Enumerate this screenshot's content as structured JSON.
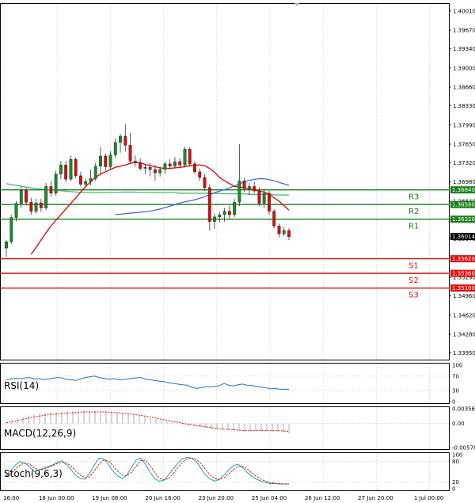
{
  "chart_data": {
    "type": "candlestick",
    "instrument_timeframe": "",
    "main": {
      "price_ticks": [
        1.4001,
        1.3967,
        1.3934,
        1.39,
        1.3866,
        1.3833,
        1.3799,
        1.3765,
        1.3732,
        1.3698,
        1.3664,
        1.3631,
        1.3597,
        1.3563,
        1.3529,
        1.3496,
        1.3462,
        1.3428,
        1.3395
      ],
      "price_tick_labels": [
        "1.40010",
        "1.39670",
        "1.39340",
        "1.39000",
        "1.38660",
        "1.38330",
        "1.37990",
        "1.37650",
        "1.37320",
        "1.36980",
        "1.36640",
        "1.36310",
        "1.35970",
        "1.35630",
        "1.35290",
        "1.34960",
        "1.34620",
        "1.34280",
        "1.33950"
      ],
      "ylim": [
        1.3386,
        1.4012
      ],
      "x_labels": [
        "16:00",
        "18 Jun 00:00",
        "19 Jun 08:00",
        "20 Jun 16:00",
        "23 Jun 20:00",
        "25 Jun 04:00",
        "26 Jun 12:00",
        "27 Jun 20:00",
        "1 Jul 00:00"
      ],
      "x_label_positions": [
        0,
        12,
        24,
        36,
        48,
        60,
        72,
        84,
        96
      ],
      "bars_count": 100,
      "current_price": "1.36014",
      "current_price_value": 1.36014,
      "levels": [
        {
          "name": "R3",
          "price": 1.3684,
          "label": "1.36840",
          "color": "#1a7f1a"
        },
        {
          "name": "R2",
          "price": 1.3658,
          "label": "1.36580",
          "color": "#1a7f1a"
        },
        {
          "name": "R1",
          "price": 1.3632,
          "label": "1.36320",
          "color": "#1a7f1a"
        },
        {
          "name": "S1",
          "price": 1.3562,
          "label": "1.35620",
          "color": "#e01010"
        },
        {
          "name": "S2",
          "price": 1.3536,
          "label": "1.35360",
          "color": "#e01010"
        },
        {
          "name": "S3",
          "price": 1.351,
          "label": "1.35100",
          "color": "#e01010"
        }
      ],
      "candles": [
        {
          "o": 1.3581,
          "h": 1.3595,
          "l": 1.3566,
          "c": 1.3592
        },
        {
          "o": 1.3592,
          "h": 1.364,
          "l": 1.3588,
          "c": 1.3635
        },
        {
          "o": 1.3635,
          "h": 1.3664,
          "l": 1.3628,
          "c": 1.366
        },
        {
          "o": 1.366,
          "h": 1.369,
          "l": 1.3652,
          "c": 1.3683
        },
        {
          "o": 1.3683,
          "h": 1.3688,
          "l": 1.3656,
          "c": 1.3662
        },
        {
          "o": 1.3662,
          "h": 1.367,
          "l": 1.364,
          "c": 1.3646
        },
        {
          "o": 1.3646,
          "h": 1.3668,
          "l": 1.3642,
          "c": 1.3661
        },
        {
          "o": 1.3661,
          "h": 1.3668,
          "l": 1.3645,
          "c": 1.3652
        },
        {
          "o": 1.3652,
          "h": 1.3696,
          "l": 1.3648,
          "c": 1.369
        },
        {
          "o": 1.369,
          "h": 1.37,
          "l": 1.3672,
          "c": 1.3678
        },
        {
          "o": 1.3678,
          "h": 1.3718,
          "l": 1.3674,
          "c": 1.3712
        },
        {
          "o": 1.3712,
          "h": 1.3735,
          "l": 1.3703,
          "c": 1.3728
        },
        {
          "o": 1.3728,
          "h": 1.3735,
          "l": 1.3698,
          "c": 1.3703
        },
        {
          "o": 1.3703,
          "h": 1.3745,
          "l": 1.37,
          "c": 1.3738
        },
        {
          "o": 1.3738,
          "h": 1.3742,
          "l": 1.3704,
          "c": 1.3709
        },
        {
          "o": 1.3709,
          "h": 1.3716,
          "l": 1.369,
          "c": 1.3694
        },
        {
          "o": 1.3694,
          "h": 1.3704,
          "l": 1.3688,
          "c": 1.3699
        },
        {
          "o": 1.3699,
          "h": 1.372,
          "l": 1.3692,
          "c": 1.3704
        },
        {
          "o": 1.3704,
          "h": 1.3732,
          "l": 1.37,
          "c": 1.3726
        },
        {
          "o": 1.3726,
          "h": 1.376,
          "l": 1.3712,
          "c": 1.3744
        },
        {
          "o": 1.3744,
          "h": 1.3748,
          "l": 1.3718,
          "c": 1.3725
        },
        {
          "o": 1.3725,
          "h": 1.3752,
          "l": 1.372,
          "c": 1.3746
        },
        {
          "o": 1.3746,
          "h": 1.3775,
          "l": 1.374,
          "c": 1.3768
        },
        {
          "o": 1.3768,
          "h": 1.3783,
          "l": 1.375,
          "c": 1.3779
        },
        {
          "o": 1.3779,
          "h": 1.38,
          "l": 1.3752,
          "c": 1.3763
        },
        {
          "o": 1.3763,
          "h": 1.3785,
          "l": 1.373,
          "c": 1.3735
        },
        {
          "o": 1.3735,
          "h": 1.3745,
          "l": 1.3725,
          "c": 1.3732
        },
        {
          "o": 1.3732,
          "h": 1.374,
          "l": 1.3718,
          "c": 1.3722
        },
        {
          "o": 1.3722,
          "h": 1.373,
          "l": 1.3712,
          "c": 1.3724
        },
        {
          "o": 1.3724,
          "h": 1.3732,
          "l": 1.3708,
          "c": 1.372
        },
        {
          "o": 1.372,
          "h": 1.3728,
          "l": 1.37,
          "c": 1.3714
        },
        {
          "o": 1.3714,
          "h": 1.3725,
          "l": 1.3708,
          "c": 1.372
        },
        {
          "o": 1.372,
          "h": 1.3734,
          "l": 1.3712,
          "c": 1.373
        },
        {
          "o": 1.373,
          "h": 1.3738,
          "l": 1.372,
          "c": 1.3726
        },
        {
          "o": 1.3726,
          "h": 1.3742,
          "l": 1.3722,
          "c": 1.3734
        },
        {
          "o": 1.3734,
          "h": 1.374,
          "l": 1.3722,
          "c": 1.3728
        },
        {
          "o": 1.3728,
          "h": 1.376,
          "l": 1.3724,
          "c": 1.3756
        },
        {
          "o": 1.3756,
          "h": 1.376,
          "l": 1.3725,
          "c": 1.373
        },
        {
          "o": 1.373,
          "h": 1.3735,
          "l": 1.3712,
          "c": 1.3716
        },
        {
          "o": 1.3716,
          "h": 1.3722,
          "l": 1.37,
          "c": 1.3706
        },
        {
          "o": 1.3706,
          "h": 1.3712,
          "l": 1.3682,
          "c": 1.3688
        },
        {
          "o": 1.3688,
          "h": 1.3694,
          "l": 1.3612,
          "c": 1.3628
        },
        {
          "o": 1.3628,
          "h": 1.3642,
          "l": 1.3615,
          "c": 1.3636
        },
        {
          "o": 1.3636,
          "h": 1.3645,
          "l": 1.3626,
          "c": 1.364
        },
        {
          "o": 1.364,
          "h": 1.3652,
          "l": 1.3628,
          "c": 1.3646
        },
        {
          "o": 1.3646,
          "h": 1.3656,
          "l": 1.3632,
          "c": 1.364
        },
        {
          "o": 1.364,
          "h": 1.3668,
          "l": 1.3636,
          "c": 1.3662
        },
        {
          "o": 1.3662,
          "h": 1.3765,
          "l": 1.3655,
          "c": 1.37
        },
        {
          "o": 1.37,
          "h": 1.3705,
          "l": 1.368,
          "c": 1.3686
        },
        {
          "o": 1.3686,
          "h": 1.3696,
          "l": 1.3675,
          "c": 1.369
        },
        {
          "o": 1.369,
          "h": 1.3698,
          "l": 1.3678,
          "c": 1.3682
        },
        {
          "o": 1.3682,
          "h": 1.3688,
          "l": 1.3655,
          "c": 1.366
        },
        {
          "o": 1.366,
          "h": 1.3686,
          "l": 1.3652,
          "c": 1.3678
        },
        {
          "o": 1.3678,
          "h": 1.3682,
          "l": 1.364,
          "c": 1.3646
        },
        {
          "o": 1.3646,
          "h": 1.365,
          "l": 1.3615,
          "c": 1.362
        },
        {
          "o": 1.362,
          "h": 1.3624,
          "l": 1.36,
          "c": 1.3606
        },
        {
          "o": 1.3606,
          "h": 1.3618,
          "l": 1.3602,
          "c": 1.3612
        },
        {
          "o": 1.3612,
          "h": 1.3616,
          "l": 1.3595,
          "c": 1.3601
        }
      ],
      "ma_red": [
        1.357,
        1.3582,
        1.3595,
        1.3608,
        1.362,
        1.363,
        1.364,
        1.365,
        1.366,
        1.367,
        1.368,
        1.369,
        1.3698,
        1.3706,
        1.3712,
        1.3716,
        1.372,
        1.3724,
        1.3726,
        1.3728,
        1.3731,
        1.3733,
        1.3732,
        1.3729,
        1.3727,
        1.3725,
        1.3723,
        1.3722,
        1.3722,
        1.3723,
        1.3724,
        1.3725,
        1.3727,
        1.3728,
        1.3728,
        1.3727,
        1.3722,
        1.3715,
        1.3706,
        1.37,
        1.3695,
        1.369,
        1.3689,
        1.3688,
        1.3686,
        1.3684,
        1.3682,
        1.368,
        1.3676,
        1.367,
        1.3664,
        1.3656,
        1.3648
      ],
      "ma_red_start": 5,
      "ma_blue": [
        1.364,
        1.3641,
        1.3642,
        1.3643,
        1.3644,
        1.3645,
        1.3646,
        1.3648,
        1.365,
        1.3653,
        1.3656,
        1.3659,
        1.3662,
        1.3664,
        1.3666,
        1.3669,
        1.3672,
        1.3676,
        1.368,
        1.3683,
        1.3686,
        1.369,
        1.3694,
        1.3698,
        1.3701,
        1.3703,
        1.3704,
        1.3703,
        1.3701,
        1.3698,
        1.3695,
        1.3692
      ],
      "ma_blue_start": 22,
      "ma_green": [
        1.3695,
        1.3693,
        1.3691,
        1.3689,
        1.3687,
        1.3686,
        1.3685,
        1.3684,
        1.3683,
        1.3682,
        1.3681,
        1.368,
        1.3679,
        1.3679,
        1.3679,
        1.3679,
        1.3679,
        1.3679,
        1.368,
        1.368,
        1.368,
        1.3679,
        1.3679,
        1.3679,
        1.3679,
        1.3679,
        1.3679,
        1.3678,
        1.3678,
        1.3678,
        1.3678,
        1.3678,
        1.3678,
        1.3678,
        1.3677,
        1.3677,
        1.3677,
        1.3677,
        1.3676,
        1.3676,
        1.3676,
        1.3676,
        1.3675,
        1.3675,
        1.3675
      ],
      "ma_green_start": 0
    },
    "rsi": {
      "label": "RSI(14)",
      "ticks": [
        "100",
        "70",
        "30",
        "0"
      ],
      "tick_values": [
        100,
        70,
        30,
        0
      ],
      "color": "#1e6fd9",
      "values": [
        60,
        62,
        64,
        63,
        65,
        66,
        62,
        63,
        60,
        62,
        64,
        66,
        65,
        61,
        60,
        58,
        62,
        66,
        68,
        70,
        66,
        64,
        62,
        63,
        61,
        60,
        62,
        64,
        65,
        66,
        62,
        60,
        58,
        56,
        55,
        52,
        50,
        48,
        46,
        45,
        40,
        36,
        38,
        41,
        40,
        42,
        44,
        50,
        45,
        43,
        46,
        48,
        45,
        44,
        42,
        40,
        38,
        35,
        36,
        34,
        34,
        33
      ]
    },
    "macd": {
      "label": "MACD(12,26,9)",
      "ticks": [
        "0.003568",
        "0.00",
        "-0.005789"
      ],
      "tick_values": [
        0.003568,
        0.0,
        -0.005789
      ],
      "histogram": [
        0.0005,
        0.0008,
        0.0012,
        0.0016,
        0.002,
        0.0023,
        0.0025,
        0.0026,
        0.0027,
        0.0028,
        0.0029,
        0.003,
        0.003,
        0.0031,
        0.0031,
        0.0031,
        0.0031,
        0.003,
        0.0029,
        0.0028,
        0.0027,
        0.0026,
        0.0024,
        0.0022,
        0.0019,
        0.0016,
        0.0013,
        0.001,
        0.0007,
        0.0004,
        0.0002,
        0.0,
        -0.0003,
        -0.0005,
        -0.0007,
        -0.0009,
        -0.0011,
        -0.0013,
        -0.0015,
        -0.0016,
        -0.0017,
        -0.0018,
        -0.0018,
        -0.0019,
        -0.0019,
        -0.0019,
        -0.0018,
        -0.0018,
        -0.0019,
        -0.002,
        -0.0022,
        -0.0024
      ],
      "signal_color": "#e01010",
      "signal": [
        0.0002,
        0.0004,
        0.0007,
        0.001,
        0.0013,
        0.0016,
        0.0018,
        0.002,
        0.0022,
        0.0023,
        0.0024,
        0.0025,
        0.0026,
        0.0027,
        0.0028,
        0.0028,
        0.0028,
        0.0028,
        0.0028,
        0.0027,
        0.0026,
        0.0025,
        0.0024,
        0.0022,
        0.002,
        0.0018,
        0.0016,
        0.0013,
        0.001,
        0.0008,
        0.0005,
        0.0003,
        0.0,
        -0.0002,
        -0.0004,
        -0.0006,
        -0.0008,
        -0.001,
        -0.0012,
        -0.0013,
        -0.0014,
        -0.0015,
        -0.0016,
        -0.0017,
        -0.0017,
        -0.0017,
        -0.0017,
        -0.0017,
        -0.0017,
        -0.0017,
        -0.0018,
        -0.0019
      ]
    },
    "stoch": {
      "label": "Stoch(9,6,3)",
      "ticks": [
        "100",
        "80",
        "20",
        "0"
      ],
      "tick_values": [
        100,
        80,
        20,
        0
      ],
      "main_color": "#1aa6a6",
      "signal_color": "#e01010",
      "main": [
        40,
        55,
        70,
        80,
        75,
        65,
        50,
        55,
        60,
        65,
        70,
        78,
        82,
        70,
        55,
        40,
        30,
        28,
        45,
        70,
        90,
        88,
        72,
        52,
        38,
        30,
        40,
        62,
        84,
        90,
        72,
        50,
        30,
        22,
        25,
        40,
        58,
        75,
        88,
        92,
        90,
        80,
        60,
        40,
        28,
        22,
        28,
        40,
        55,
        68,
        72,
        62,
        48,
        36,
        28,
        22,
        18,
        15,
        15,
        14,
        14,
        14
      ],
      "signal": [
        38,
        45,
        58,
        70,
        76,
        72,
        62,
        55,
        57,
        62,
        68,
        74,
        78,
        76,
        66,
        52,
        40,
        32,
        35,
        52,
        72,
        84,
        82,
        68,
        52,
        40,
        38,
        48,
        66,
        82,
        84,
        68,
        48,
        32,
        26,
        30,
        44,
        62,
        78,
        88,
        90,
        86,
        74,
        56,
        40,
        30,
        26,
        32,
        44,
        56,
        66,
        66,
        58,
        46,
        36,
        28,
        22,
        18,
        16,
        15,
        14,
        14
      ]
    }
  }
}
